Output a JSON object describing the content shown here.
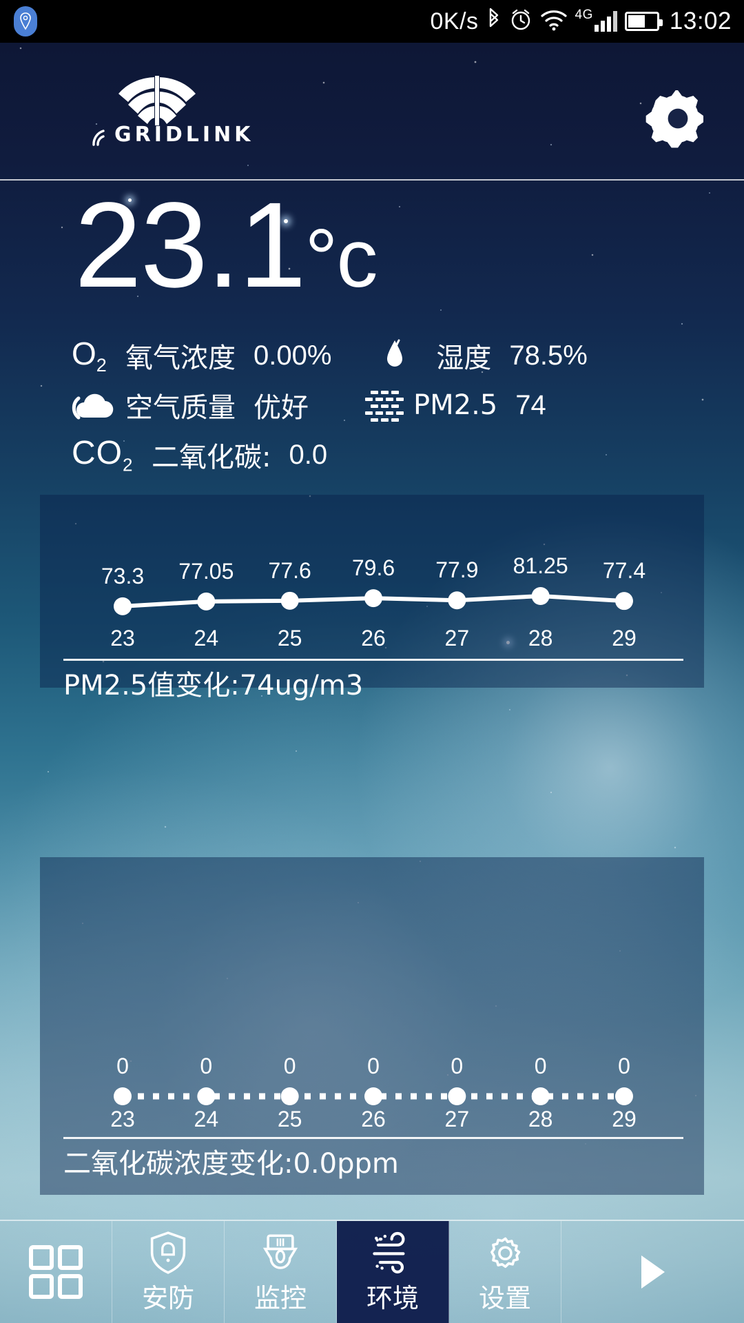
{
  "status_bar": {
    "location_icon": "location-pin-icon",
    "net_speed": "0K/s",
    "bluetooth_icon": "bluetooth-icon",
    "alarm_icon": "alarm-clock-icon",
    "wifi_icon": "wifi-icon",
    "mobile_network": "4G",
    "signal_icon": "signal-bars-icon",
    "battery_icon": "battery-icon",
    "time": "13:02"
  },
  "header": {
    "logo_text": "GRIDLINK",
    "logo_icon": "gridlink-fan-logo",
    "settings_icon": "gear-icon"
  },
  "main": {
    "temperature": "23.1",
    "temperature_unit": "°c",
    "readouts": [
      {
        "icon": "o2-icon",
        "label": "氧气浓度",
        "value": "0.00%"
      },
      {
        "icon": "humidity-drop-icon",
        "label": "湿度",
        "value": "78.5%"
      },
      {
        "icon": "cloud-icon",
        "label": "空气质量",
        "value": "优好"
      },
      {
        "icon": "pm25-dots-icon",
        "label": "PM2.5",
        "value": "74"
      },
      {
        "icon": "co2-icon",
        "label": "二氧化碳:",
        "value": "0.0"
      }
    ]
  },
  "chart_data": [
    {
      "type": "line",
      "name": "pm25-chart",
      "title": "PM2.5值变化:74ug/m3",
      "categories": [
        "23",
        "24",
        "25",
        "26",
        "27",
        "28",
        "29"
      ],
      "values": [
        73.3,
        77.05,
        77.6,
        79.6,
        77.9,
        81.25,
        77.4
      ],
      "xlabel": "",
      "ylabel": "",
      "ylim": [
        70,
        85
      ],
      "grid": false,
      "legend": "none",
      "line_style": "solid",
      "line_color": "#ffffff",
      "point_color": "#ffffff"
    },
    {
      "type": "line",
      "name": "co2-chart",
      "title": "二氧化碳浓度变化:0.0ppm",
      "categories": [
        "23",
        "24",
        "25",
        "26",
        "27",
        "28",
        "29"
      ],
      "values": [
        0,
        0,
        0,
        0,
        0,
        0,
        0
      ],
      "xlabel": "",
      "ylabel": "",
      "ylim": [
        0,
        1
      ],
      "grid": false,
      "legend": "none",
      "line_style": "dotted",
      "line_color": "#ffffff",
      "point_color": "#ffffff"
    }
  ],
  "nav": {
    "items": [
      {
        "icon": "grid-apps-icon",
        "label": ""
      },
      {
        "icon": "shield-alarm-icon",
        "label": "安防"
      },
      {
        "icon": "cctv-camera-icon",
        "label": "监控"
      },
      {
        "icon": "wind-icon",
        "label": "环境"
      },
      {
        "icon": "gear-icon",
        "label": "设置"
      }
    ],
    "active_index": 3,
    "more_icon": "play-arrow-icon"
  }
}
